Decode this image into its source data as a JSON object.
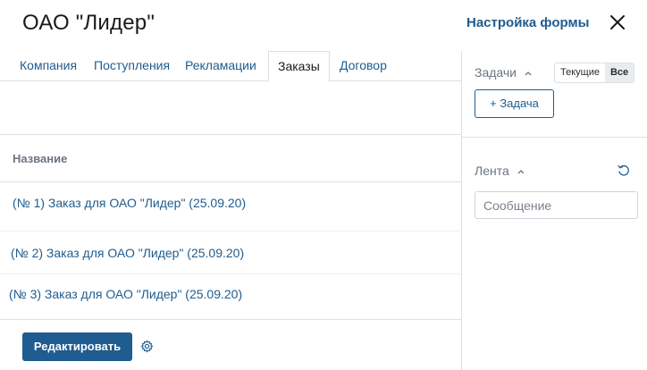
{
  "header": {
    "title": "ОАО \"Лидер\"",
    "settings_link": "Настройка формы",
    "close_icon": "close-icon"
  },
  "tabs": [
    {
      "label": "Компания"
    },
    {
      "label": "Поступления"
    },
    {
      "label": "Рекламации"
    },
    {
      "label": "Заказы",
      "active": true
    },
    {
      "label": "Договор"
    }
  ],
  "table": {
    "column_header": "Название",
    "rows": [
      "(№ 1) Заказ для ОАО \"Лидер\" (25.09.20)",
      "(№ 2) Заказ для ОАО \"Лидер\" (25.09.20)",
      "(№ 3) Заказ для ОАО \"Лидер\" (25.09.20)"
    ]
  },
  "footer": {
    "edit_button": "Редактировать",
    "gear_icon": "gear-icon"
  },
  "sidebar": {
    "tasks_label": "Задачи",
    "toggle": {
      "current": "Текущие",
      "all": "Все",
      "selected": "Все"
    },
    "add_task_button": "+ Задача",
    "feed_label": "Лента",
    "message_placeholder": "Сообщение"
  },
  "colors": {
    "accent": "#1f5c8f",
    "border": "#dcdfe3",
    "muted": "#6b7480"
  }
}
